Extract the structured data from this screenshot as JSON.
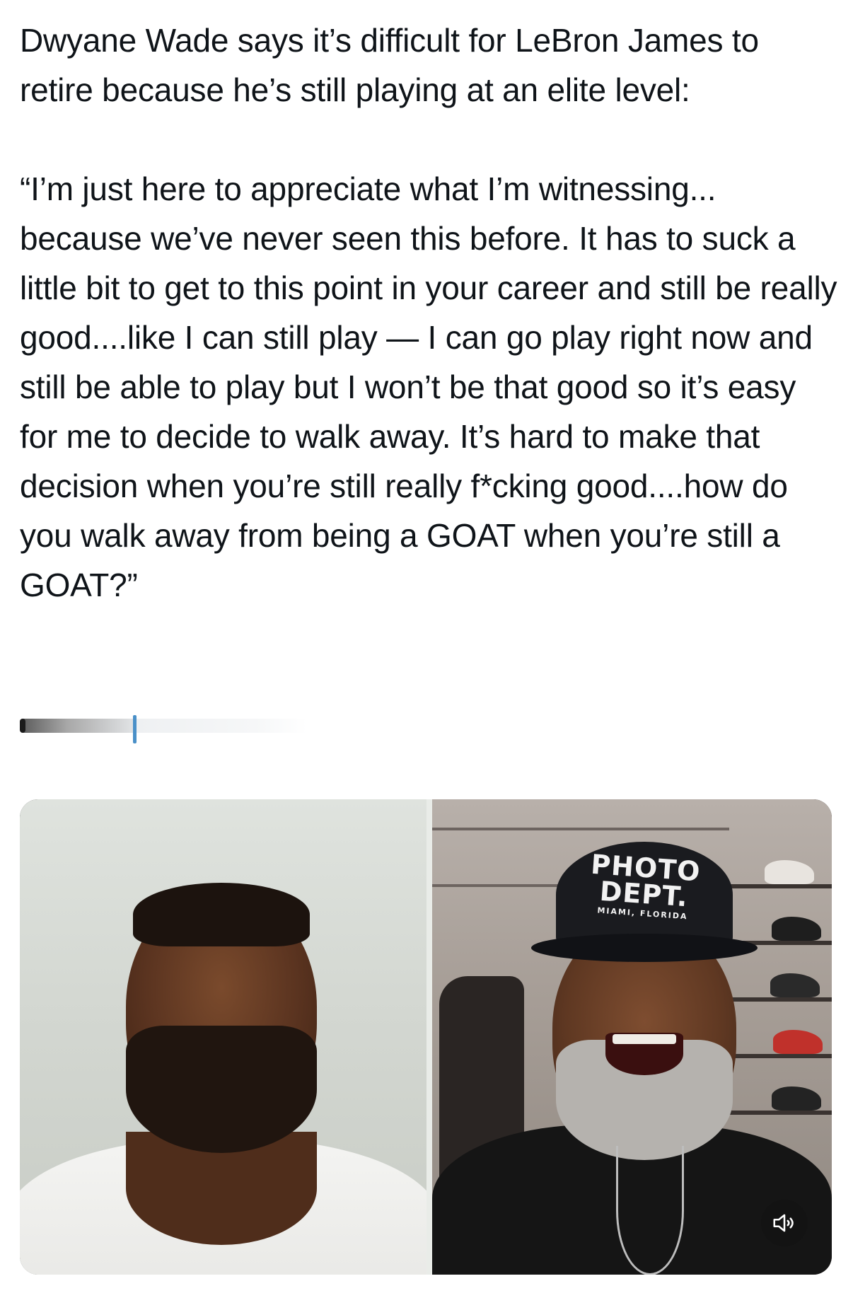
{
  "tweet": {
    "intro": "Dwyane Wade says it’s difficult for LeBron James to retire because he’s still playing at an elite level:",
    "quote": "“I’m just here to appreciate what I’m witnessing... because we’ve never seen this before. It has to suck a little bit to get to this point in your career and still be really good....like I can still play — I can go play right now and still be able to play but I won’t be that good so it’s easy for me to decide to walk away. It’s hard to make that decision when you’re still really f*cking good....how do you walk away from being a GOAT when you’re still a GOAT?”"
  },
  "progress": {
    "fraction": 0.4
  },
  "media": {
    "cap_line1": "PHOTO",
    "cap_line2": "DEPT.",
    "cap_line3": "MIAMI, FLORIDA",
    "mute_icon": "speaker-muted-icon"
  },
  "colors": {
    "text": "#0f1419",
    "background": "#ffffff",
    "progress_thumb": "#4a90c8"
  }
}
